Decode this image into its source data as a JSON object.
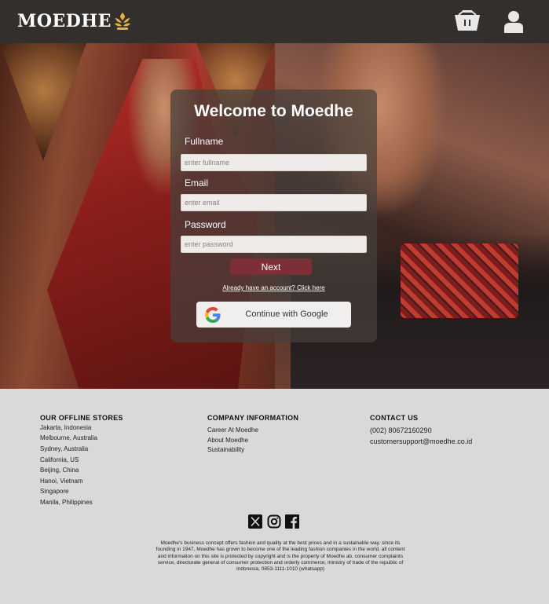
{
  "header": {
    "brand": "MOEDHE",
    "icons": [
      "basket-icon",
      "user-icon"
    ]
  },
  "login_card": {
    "title": "Welcome to Moedhe",
    "fullname_label": "Fullname",
    "fullname_placeholder": "enter fullname",
    "email_label": "Email",
    "email_placeholder": "enter email",
    "password_label": "Password",
    "password_placeholder": "enter password",
    "next_label": "Next",
    "account_link": "Already have an account? Click here",
    "google_label": "Continue with Google"
  },
  "footer": {
    "stores_title": "OUR OFFLINE STORES",
    "stores": [
      "Jakarta, Indonesia",
      "Melbourne, Australia",
      "Sydney, Australia",
      "California, US",
      "Beijing, China",
      "Hanoi, Vietnam",
      "Singapore",
      "Manila, Philippines"
    ],
    "company_title": "COMPANY INFORMATION",
    "company": [
      "Career At Moedhe",
      "About Moedhe",
      "Sustainability"
    ],
    "contact_title": "CONTACT US",
    "contact": [
      "(002) 80672160290",
      "customersupport@moedhe.co.id"
    ],
    "social_icons": [
      "x-icon",
      "instagram-icon",
      "facebook-icon"
    ],
    "copyright": "Moedhe's business concept offers fashion and quality at the best prices and in a sustainable way. since its founding in 1947, Moedhe has grown to become one of the leading fashion companies in the world. all content and information on this site is protected by copyright and is the property of Moedhe ab. consumer complaints service, directorate general of consumer protection and orderly commerce, ministry of trade of the republic of Indonesia, 0853-1111-1010 (whatsapp)"
  },
  "colors": {
    "header_bg": "#332f2c",
    "next_button": "#7c2f36",
    "footer_bg": "#d9d9d9"
  }
}
